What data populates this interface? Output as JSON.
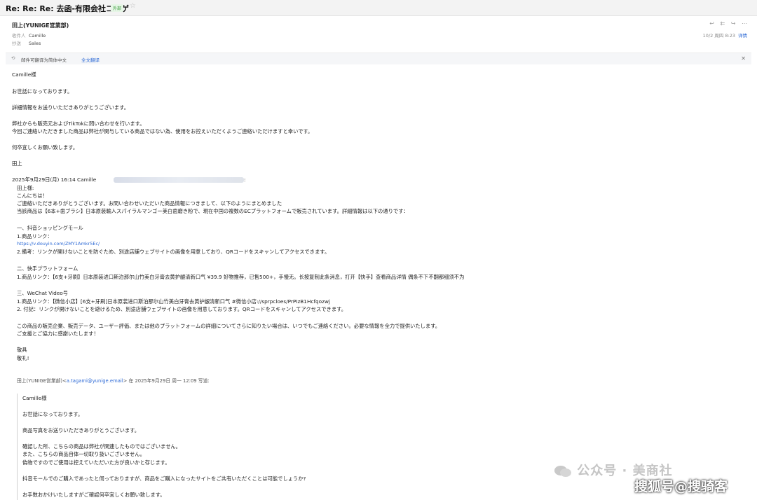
{
  "subject": "Re: Re: Re: 去函-有限会社コニゲ",
  "subject_tag": "外部",
  "star_icon": "star-icon",
  "sender": "田上(YUNIGE営業部)",
  "recipient": {
    "label": "收件人",
    "value": "Camille"
  },
  "cc": {
    "label": "抄送",
    "value": "Sales"
  },
  "toolbar_icons": [
    "reply-icon",
    "reply-all-icon",
    "forward-icon",
    "more-icon"
  ],
  "datetime": "10/2 周四 8:23",
  "details_link": "详情",
  "translate": {
    "message": "邮件可翻译为简体中文",
    "action": "全文翻译"
  },
  "body_lines": [
    "Camille様",
    "お世話になっております。",
    "詳細情報をお送りいただきありがとうございます。",
    "弊社からも販売元およびTikTokに問い合わせを行います。",
    "今回ご連絡いただきました商品は弊社が関与している商品ではない為、使用をお控えいただくようご連絡いただけますと幸いです。",
    "何卒宜しくお願い致します。",
    "田上"
  ],
  "quote1": {
    "header": "2025年9月29日(月) 16:14 Camille",
    "header_tail": ":",
    "lines": [
      "田上様:",
      "こんにちは！",
      "ご連絡いただきありがとうございます。お問い合わせいただいた商品情報につきまして、以下のようにまとめました",
      "当該商品は【6本+歯ブラシ】日本原装輸入スパイラルマンゴー美白歯磨き粉で、現在中国の複数のECプラットフォームで販売されています。詳細情報は以下の通りです：",
      "一、抖音ショッピングモール",
      "1.商品リンク：",
      "https://v.douyin.com/ZMY1Amkr5Ec/",
      "2.備考：リンクが開けないことを防ぐため、別途店舗ウェブサイトの画像を用意しており、QRコードをスキャンしてアクセスできます。",
      "二、快手プラットフォーム",
      "1.商品リンク：【6支+牙刷】日本原装进口斯泊那尔山竹美白牙膏去黄护龈清新口气 ¥39.9 好物推荐，已售500+，手慢无。长按复制此条消息，打开【快手】查看商品详情 偶条不下不翻都细须不为",
      "三、WeChat Video号",
      "1.商品リンク：【微信小店】[6支+牙刷]日本原装进口斯泊那尔山竹美白牙膏去黄护龈清新口气  #微信小店://sprpcloes/PrPIzB1Hcfqozwj",
      "2. 付記：リンクが開けないことを避けるため、別途店舗ウェブサイトの画像を用意しております。QRコードをスキャンしてアクセスできます。",
      "この商品の販売企業、販売データ、ユーザー評価、または他のプラットフォームの詳細についてさらに知りたい場合は、いつでもご連絡ください。必要な情報を全力で提供いたします。",
      "ご支援とご協力に感謝いたします！",
      "敬具",
      "敬礼!"
    ]
  },
  "quote2": {
    "header_pre": "田上(YUNIGE営業部)<",
    "header_email": "a.tagami@yunige.email",
    "header_post": "> 在 2025年9月29日 周一 12:09 写道:",
    "lines": [
      "Camille様",
      "お世話になっております。",
      "商品写真をお送りいただきありがとうございます。",
      "確認した所、こちらの商品は弊社が関連したものではございません。",
      "また、こちらの商品自体一切取り扱いございません。",
      "偽物ですのでご使用は控えていただいた方が良いかと存じます。",
      "抖音モールでのご購入であったと伺っておりますが、商品をご購入になったサイトをご共有いただくことは可能でしょうか?",
      "お手数おかけいたしますがご確認何卒宜しくお願い致します。"
    ]
  },
  "watermark1": "公众号 · 美商社",
  "watermark2": "搜狐号@搜骑客"
}
